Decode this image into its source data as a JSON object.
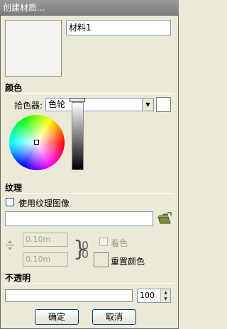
{
  "window": {
    "title": "创建材质..."
  },
  "material": {
    "name_value": "材料1"
  },
  "color_section": {
    "title": "颜色",
    "picker_label": "拾色器:",
    "picker_selected": "色轮"
  },
  "texture_section": {
    "title": "纹理",
    "use_texture_label": "使用纹理图像",
    "path_value": "",
    "width_value": "0.10m",
    "height_value": "0.10m",
    "colorize_label": "着色",
    "reset_color_label": "重置颜色"
  },
  "opacity_section": {
    "title": "不透明",
    "value": "100",
    "slider_level": 1.0
  },
  "buttons": {
    "ok": "确定",
    "cancel": "取消"
  },
  "icons": [
    "folder-open-icon",
    "chain-link-icon",
    "aspect-arrows-icon",
    "dropdown-arrow-icon",
    "spin-up-icon",
    "spin-down-icon"
  ],
  "colors": {
    "title_bar": "#7c7c7c",
    "dialog_bg": "#ece9d8",
    "field_border": "#7f9db9",
    "button_border": "#003c74"
  }
}
